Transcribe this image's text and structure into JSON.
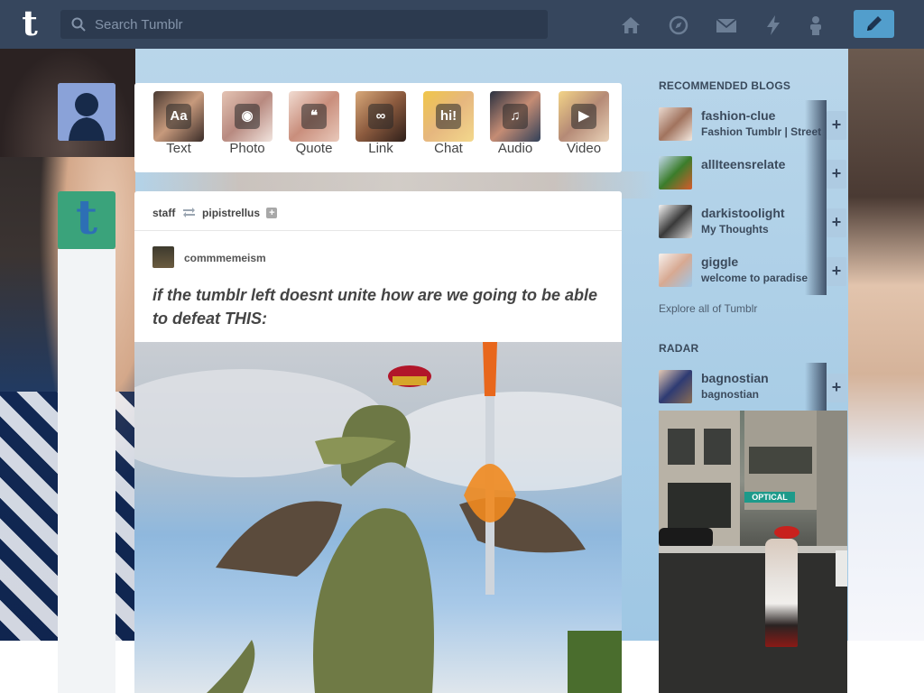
{
  "header": {
    "logo": "t",
    "search_placeholder": "Search Tumblr",
    "nav_icons": [
      "home-icon",
      "explore-icon",
      "inbox-icon",
      "activity-icon",
      "account-icon"
    ],
    "compose_icon": "pencil-icon"
  },
  "colors": {
    "header_bg": "#36465d",
    "compose_bg": "#529ecc",
    "page_bg": "#b9d6ea"
  },
  "post_types": [
    {
      "label": "Text",
      "icon": "text-icon",
      "glyph": "Aa"
    },
    {
      "label": "Photo",
      "icon": "camera-icon",
      "glyph": "◉"
    },
    {
      "label": "Quote",
      "icon": "quote-icon",
      "glyph": "❝"
    },
    {
      "label": "Link",
      "icon": "link-icon",
      "glyph": "∞"
    },
    {
      "label": "Chat",
      "icon": "chat-icon",
      "glyph": "hi!"
    },
    {
      "label": "Audio",
      "icon": "headphones-icon",
      "glyph": "♫"
    },
    {
      "label": "Video",
      "icon": "video-camera-icon",
      "glyph": "▶"
    }
  ],
  "avatar_staff_letter": "t",
  "post": {
    "reblog_from": "staff",
    "reblogged_by": "pipistrellus",
    "follow_glyph": "+",
    "source_blog": "commmemeism",
    "text": "if the tumblr left doesnt unite how are we going to be able to defeat THIS:"
  },
  "sidebar": {
    "recommended_title": "RECOMMENDED BLOGS",
    "recommended": [
      {
        "name": "fashion-clue",
        "subtitle": "Fashion Tumblr | Street Style"
      },
      {
        "name": "allIteensrelate",
        "subtitle": ""
      },
      {
        "name": "darkistoolight",
        "subtitle": "My Thoughts"
      },
      {
        "name": "giggle",
        "subtitle": "welcome to paradise"
      }
    ],
    "follow_glyph": "+",
    "explore_link": "Explore all of Tumblr",
    "radar_title": "RADAR",
    "radar": {
      "name": "bagnostian",
      "subtitle": "bagnostian",
      "store_sign": "OPTICAL"
    }
  }
}
